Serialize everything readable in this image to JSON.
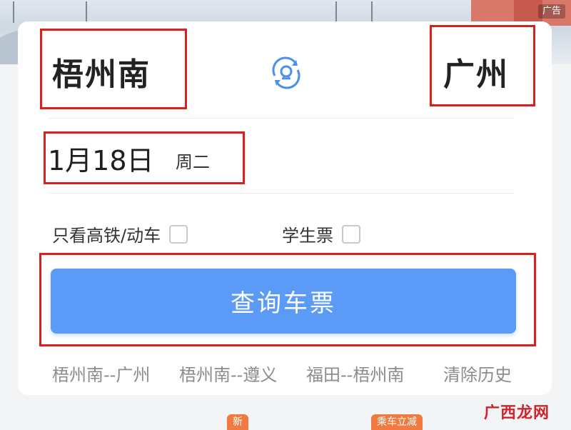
{
  "banner": {
    "ad_label": "广告"
  },
  "route": {
    "from": "梧州南",
    "to": "广州"
  },
  "date": {
    "value": "1月18日",
    "weekday": "周二"
  },
  "options": {
    "high_speed": "只看高铁/动车",
    "student": "学生票"
  },
  "search_button": "查询车票",
  "history": {
    "items": [
      "梧州南--广州",
      "梧州南--遵义",
      "福田--梧州南"
    ],
    "clear": "清除历史"
  },
  "bottom_tags": {
    "new": "新",
    "promo": "乘车立减"
  },
  "watermark": "广西龙网",
  "colors": {
    "accent": "#5b9bf7",
    "highlight": "#d9211c",
    "tag": "#f07a3f"
  }
}
